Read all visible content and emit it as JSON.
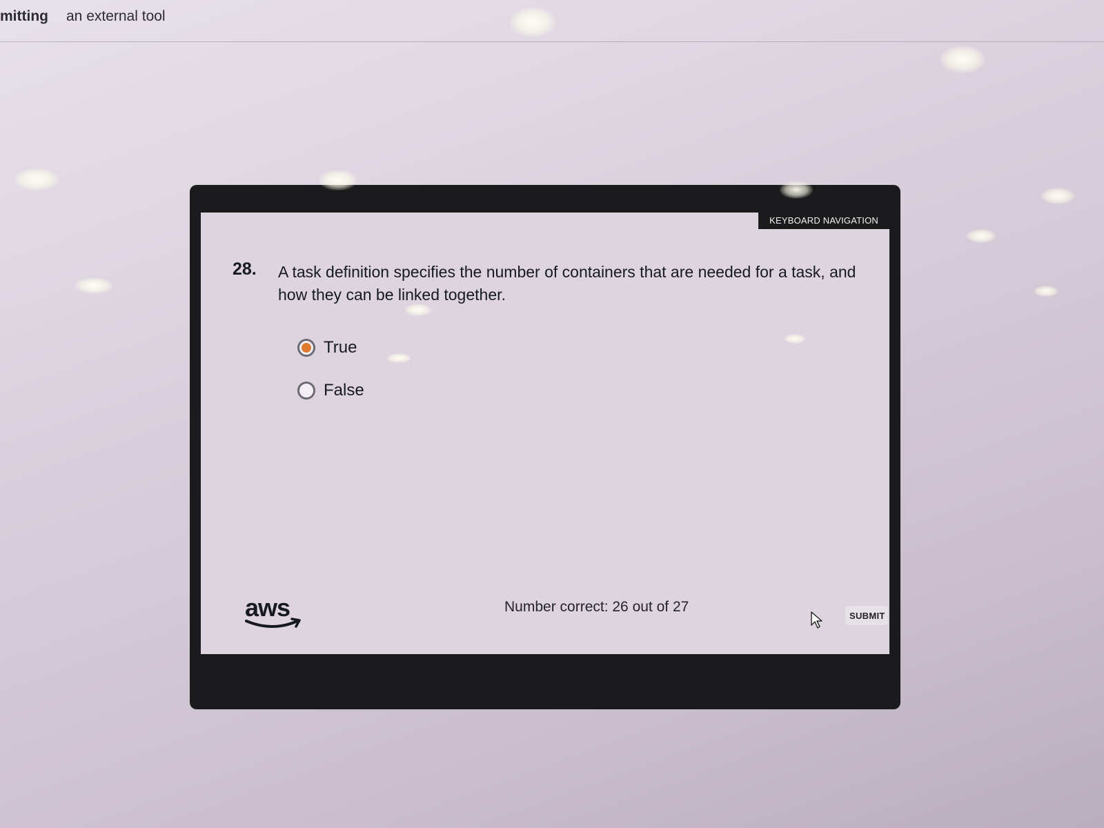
{
  "breadcrumb": {
    "first": "mitting",
    "second": "an external tool"
  },
  "quiz": {
    "keyboard_nav_label": "KEYBOARD NAVIGATION",
    "question_number": "28.",
    "question_text": "A task definition specifies the number of containers that are needed for a task, and how they can be linked together.",
    "options": [
      {
        "label": "True",
        "selected": true
      },
      {
        "label": "False",
        "selected": false
      }
    ],
    "score_text": "Number correct: 26 out of 27",
    "submit_label": "SUBMIT",
    "logo_text": "aws",
    "accent_color": "#e07a2e"
  }
}
